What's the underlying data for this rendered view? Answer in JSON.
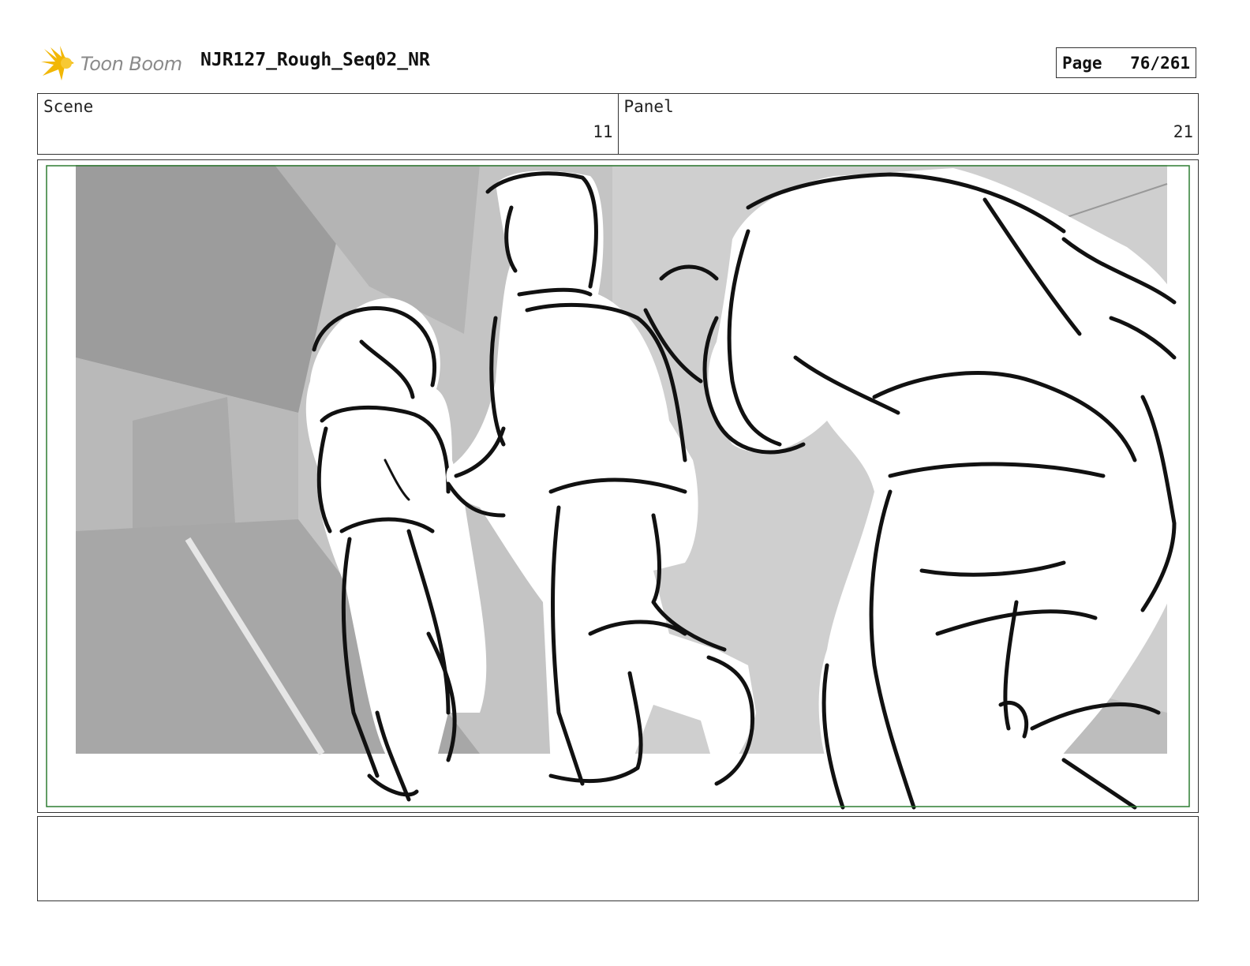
{
  "header": {
    "logo_text": "Toon Boom",
    "document_title": "NJR127_Rough_Seq02_NR",
    "page_label": "Page",
    "page_number": "76/261"
  },
  "info": {
    "scene_label": "Scene",
    "scene_value": "11",
    "panel_label": "Panel",
    "panel_value": "21"
  },
  "colors": {
    "safe_frame": "#2e7d32",
    "background_render": "#c2c2c2",
    "sky": "#9a9a9a",
    "logo_star": "#f2b705"
  }
}
